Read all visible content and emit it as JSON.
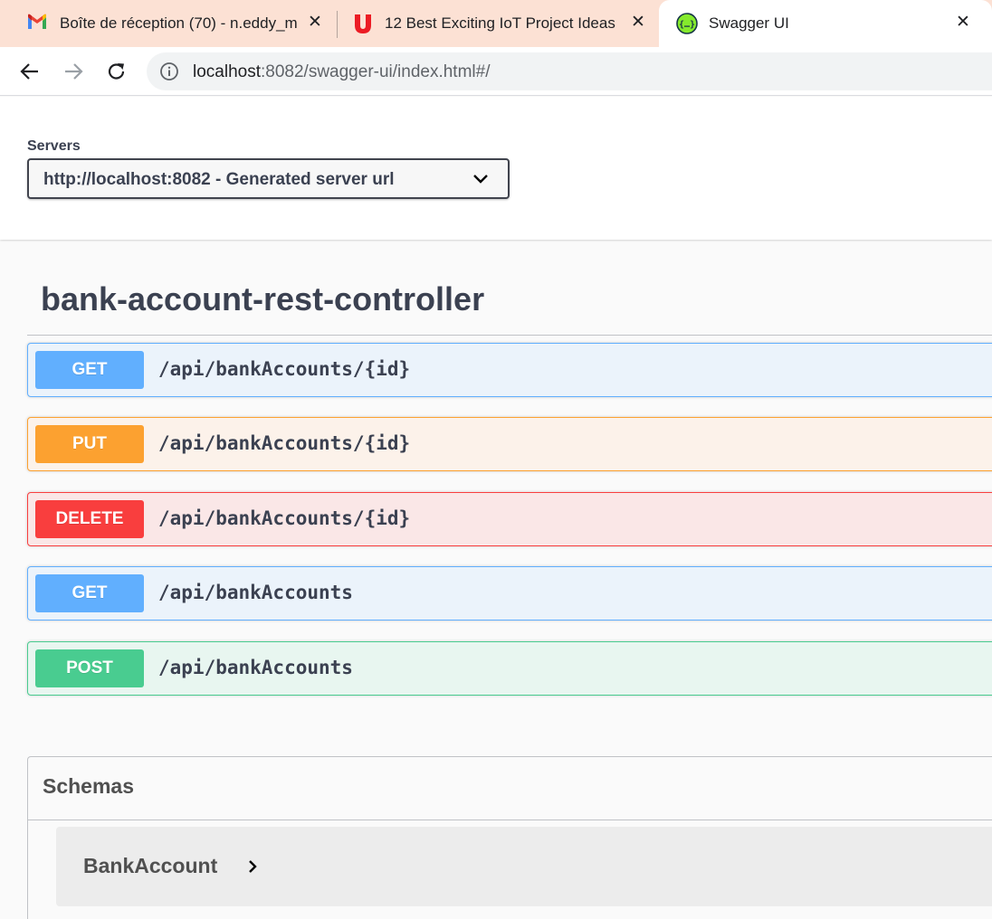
{
  "browser": {
    "tabs": [
      {
        "title": "Boîte de réception (70) - n.eddy_m",
        "icon": "gmail-icon",
        "active": false
      },
      {
        "title": "12 Best Exciting IoT Project Ideas",
        "icon": "udemy-icon",
        "active": false
      },
      {
        "title": "Swagger UI",
        "icon": "swagger-icon",
        "active": true
      }
    ],
    "url_host": "localhost",
    "url_rest": ":8082/swagger-ui/index.html#/",
    "tab_strip_color": "#fce1d4"
  },
  "servers": {
    "label": "Servers",
    "selected": "http://localhost:8082 - Generated server url"
  },
  "tag": {
    "name": "bank-account-rest-controller"
  },
  "operations": [
    {
      "method": "GET",
      "path": "/api/bankAccounts/{id}",
      "color": "#61affe"
    },
    {
      "method": "PUT",
      "path": "/api/bankAccounts/{id}",
      "color": "#fca130"
    },
    {
      "method": "DELETE",
      "path": "/api/bankAccounts/{id}",
      "color": "#f93e3e"
    },
    {
      "method": "GET",
      "path": "/api/bankAccounts",
      "color": "#61affe"
    },
    {
      "method": "POST",
      "path": "/api/bankAccounts",
      "color": "#49cc90"
    }
  ],
  "schemas": {
    "title": "Schemas",
    "models": [
      {
        "name": "BankAccount"
      }
    ]
  }
}
